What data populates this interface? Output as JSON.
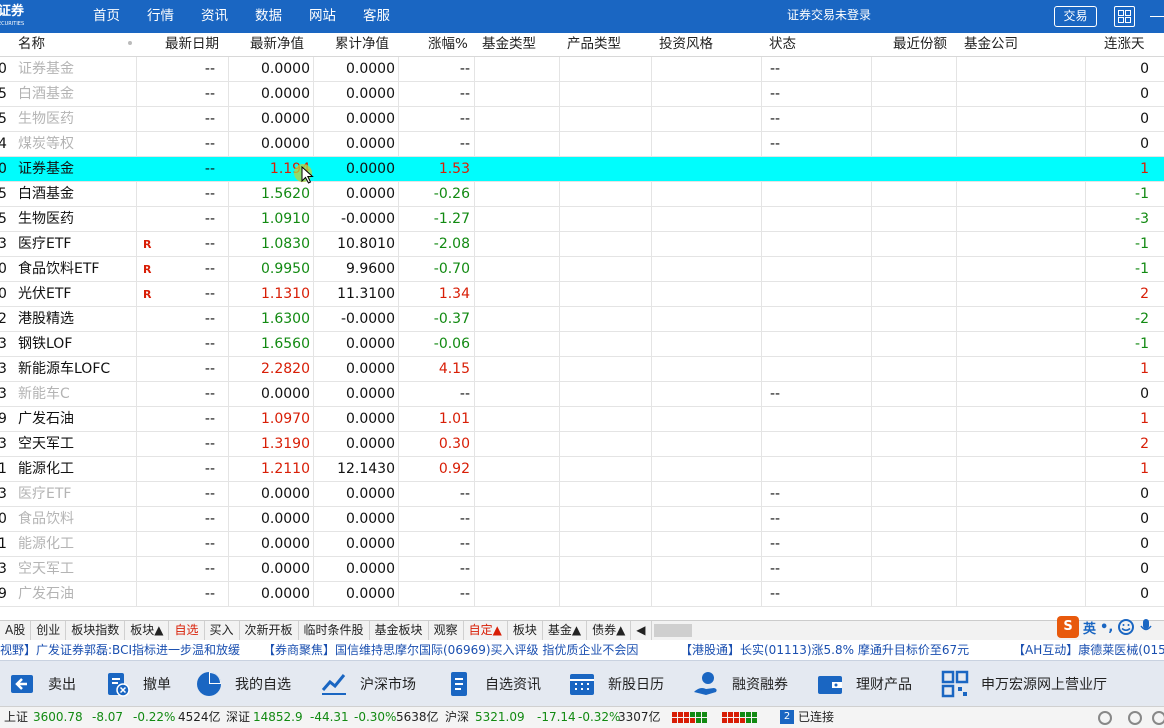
{
  "app": {
    "logo_text": "证券",
    "logo_sub": "ECURITIES",
    "nav": [
      "首页",
      "行情",
      "资讯",
      "数据",
      "网站",
      "客服"
    ],
    "login_status": "证券交易未登录",
    "trade_button": "交易"
  },
  "table": {
    "headers": {
      "name": "名称",
      "date": "最新日期",
      "nav": "最新净值",
      "acc_nav": "累计净值",
      "change": "涨幅%",
      "fund_type": "基金类型",
      "product_type": "产品类型",
      "style": "投资风格",
      "status": "状态",
      "shares": "最近份额",
      "company": "基金公司",
      "streak": "连涨天"
    },
    "rows": [
      {
        "code": "0",
        "name": "证券基金",
        "badge": "",
        "date": "--",
        "nav": "0.0000",
        "acc": "0.0000",
        "chg": "--",
        "status": "--",
        "streak": "0",
        "tone": "gray"
      },
      {
        "code": "5",
        "name": "白酒基金",
        "badge": "",
        "date": "--",
        "nav": "0.0000",
        "acc": "0.0000",
        "chg": "--",
        "status": "--",
        "streak": "0",
        "tone": "gray"
      },
      {
        "code": "5",
        "name": "生物医药",
        "badge": "",
        "date": "--",
        "nav": "0.0000",
        "acc": "0.0000",
        "chg": "--",
        "status": "--",
        "streak": "0",
        "tone": "gray"
      },
      {
        "code": "4",
        "name": "煤炭等权",
        "badge": "",
        "date": "--",
        "nav": "0.0000",
        "acc": "0.0000",
        "chg": "--",
        "status": "--",
        "streak": "0",
        "tone": "gray"
      },
      {
        "code": "0",
        "name": "证券基金",
        "badge": "",
        "date": "--",
        "nav": "1.194",
        "acc": "0.0000",
        "chg": "1.53",
        "status": "",
        "streak": "1",
        "tone": "red",
        "selected": true
      },
      {
        "code": "5",
        "name": "白酒基金",
        "badge": "",
        "date": "--",
        "nav": "1.5620",
        "acc": "0.0000",
        "chg": "-0.26",
        "status": "",
        "streak": "-1",
        "tone": "green"
      },
      {
        "code": "5",
        "name": "生物医药",
        "badge": "",
        "date": "--",
        "nav": "1.0910",
        "acc": "-0.0000",
        "chg": "-1.27",
        "status": "",
        "streak": "-3",
        "tone": "green"
      },
      {
        "code": "3",
        "name": "医疗ETF",
        "badge": "R",
        "date": "--",
        "nav": "1.0830",
        "acc": "10.8010",
        "chg": "-2.08",
        "status": "",
        "streak": "-1",
        "tone": "green"
      },
      {
        "code": "0",
        "name": "食品饮料ETF",
        "badge": "R",
        "date": "--",
        "nav": "0.9950",
        "acc": "9.9600",
        "chg": "-0.70",
        "status": "",
        "streak": "-1",
        "tone": "green"
      },
      {
        "code": "0",
        "name": "光伏ETF",
        "badge": "R",
        "date": "--",
        "nav": "1.1310",
        "acc": "11.3100",
        "chg": "1.34",
        "status": "",
        "streak": "2",
        "tone": "red"
      },
      {
        "code": "2",
        "name": "港股精选",
        "badge": "",
        "date": "--",
        "nav": "1.6300",
        "acc": "-0.0000",
        "chg": "-0.37",
        "status": "",
        "streak": "-2",
        "tone": "green"
      },
      {
        "code": "3",
        "name": "钢铁LOF",
        "badge": "",
        "date": "--",
        "nav": "1.6560",
        "acc": "0.0000",
        "chg": "-0.06",
        "status": "",
        "streak": "-1",
        "tone": "green"
      },
      {
        "code": "3",
        "name": "新能源车LOFC",
        "badge": "",
        "date": "--",
        "nav": "2.2820",
        "acc": "0.0000",
        "chg": "4.15",
        "status": "",
        "streak": "1",
        "tone": "red"
      },
      {
        "code": "3",
        "name": "新能车C",
        "badge": "",
        "date": "--",
        "nav": "0.0000",
        "acc": "0.0000",
        "chg": "--",
        "status": "--",
        "streak": "0",
        "tone": "gray"
      },
      {
        "code": "9",
        "name": "广发石油",
        "badge": "",
        "date": "--",
        "nav": "1.0970",
        "acc": "0.0000",
        "chg": "1.01",
        "status": "",
        "streak": "1",
        "tone": "red"
      },
      {
        "code": "3",
        "name": "空天军工",
        "badge": "",
        "date": "--",
        "nav": "1.3190",
        "acc": "0.0000",
        "chg": "0.30",
        "status": "",
        "streak": "2",
        "tone": "red"
      },
      {
        "code": "1",
        "name": "能源化工",
        "badge": "",
        "date": "--",
        "nav": "1.2110",
        "acc": "12.1430",
        "chg": "0.92",
        "status": "",
        "streak": "1",
        "tone": "red"
      },
      {
        "code": "3",
        "name": "医疗ETF",
        "badge": "",
        "date": "--",
        "nav": "0.0000",
        "acc": "0.0000",
        "chg": "--",
        "status": "--",
        "streak": "0",
        "tone": "gray"
      },
      {
        "code": "0",
        "name": "食品饮料",
        "badge": "",
        "date": "--",
        "nav": "0.0000",
        "acc": "0.0000",
        "chg": "--",
        "status": "--",
        "streak": "0",
        "tone": "gray"
      },
      {
        "code": "1",
        "name": "能源化工",
        "badge": "",
        "date": "--",
        "nav": "0.0000",
        "acc": "0.0000",
        "chg": "--",
        "status": "--",
        "streak": "0",
        "tone": "gray"
      },
      {
        "code": "3",
        "name": "空天军工",
        "badge": "",
        "date": "--",
        "nav": "0.0000",
        "acc": "0.0000",
        "chg": "--",
        "status": "--",
        "streak": "0",
        "tone": "gray"
      },
      {
        "code": "9",
        "name": "广发石油",
        "badge": "",
        "date": "--",
        "nav": "0.0000",
        "acc": "0.0000",
        "chg": "--",
        "status": "--",
        "streak": "0",
        "tone": "gray"
      }
    ]
  },
  "tabs": [
    {
      "label": "A股",
      "red": false
    },
    {
      "label": "创业",
      "red": false
    },
    {
      "label": "板块指数",
      "red": false
    },
    {
      "label": "板块▲",
      "red": false
    },
    {
      "label": "自选",
      "red": true
    },
    {
      "label": "买入",
      "red": false
    },
    {
      "label": "次新开板",
      "red": false
    },
    {
      "label": "临时条件股",
      "red": false
    },
    {
      "label": "基金板块",
      "red": false
    },
    {
      "label": "观察",
      "red": false
    },
    {
      "label": "自定▲",
      "red": true
    },
    {
      "label": "板块",
      "red": false
    },
    {
      "label": "基金▲",
      "red": false
    },
    {
      "label": "债券▲",
      "red": false
    },
    {
      "label": "◀",
      "red": false
    }
  ],
  "ime": {
    "mode": "英",
    "punct": "•,"
  },
  "ticker": [
    "视野】广发证券郭磊:BCI指标进一步温和放缓",
    "【券商聚焦】国信维持思摩尔国际(06969)买入评级 指优质企业不会因",
    "【港股通】长实(01113)涨5.8% 摩通升目标价至67元",
    "【AH互动】康德莱医械(0150"
  ],
  "actions": [
    {
      "label": "卖出",
      "icon": "sell-icon"
    },
    {
      "label": "撤单",
      "icon": "cancel-order-icon"
    },
    {
      "label": "我的自选",
      "icon": "pie-chart-icon"
    },
    {
      "label": "沪深市场",
      "icon": "trend-chart-icon"
    },
    {
      "label": "自选资讯",
      "icon": "document-icon"
    },
    {
      "label": "新股日历",
      "icon": "calendar-icon"
    },
    {
      "label": "融资融券",
      "icon": "hand-coin-icon"
    },
    {
      "label": "理财产品",
      "icon": "wallet-icon"
    },
    {
      "label": "申万宏源网上营业厅",
      "icon": "qr-code-icon"
    }
  ],
  "status": {
    "sh_label": "上证",
    "sh_value": "3600.78",
    "sh_change": "-8.07",
    "sh_pct": "-0.22%",
    "sh_amount": "4524亿",
    "sz_label": "深证",
    "sz_value": "14852.9",
    "sz_change": "-44.31",
    "sz_pct": "-0.30%",
    "sz_amount": "5638亿",
    "hs_label": "沪深",
    "hs_value": "5321.09",
    "hs_change": "-17.14",
    "hs_pct": "-0.32%",
    "hs_amount": "3307亿",
    "conn_count": "2",
    "conn_text": "已连接"
  },
  "colors": {
    "brand": "#1a66c2",
    "up": "#d81e06",
    "down": "#128a12",
    "selected_row": "#00fdfd"
  }
}
